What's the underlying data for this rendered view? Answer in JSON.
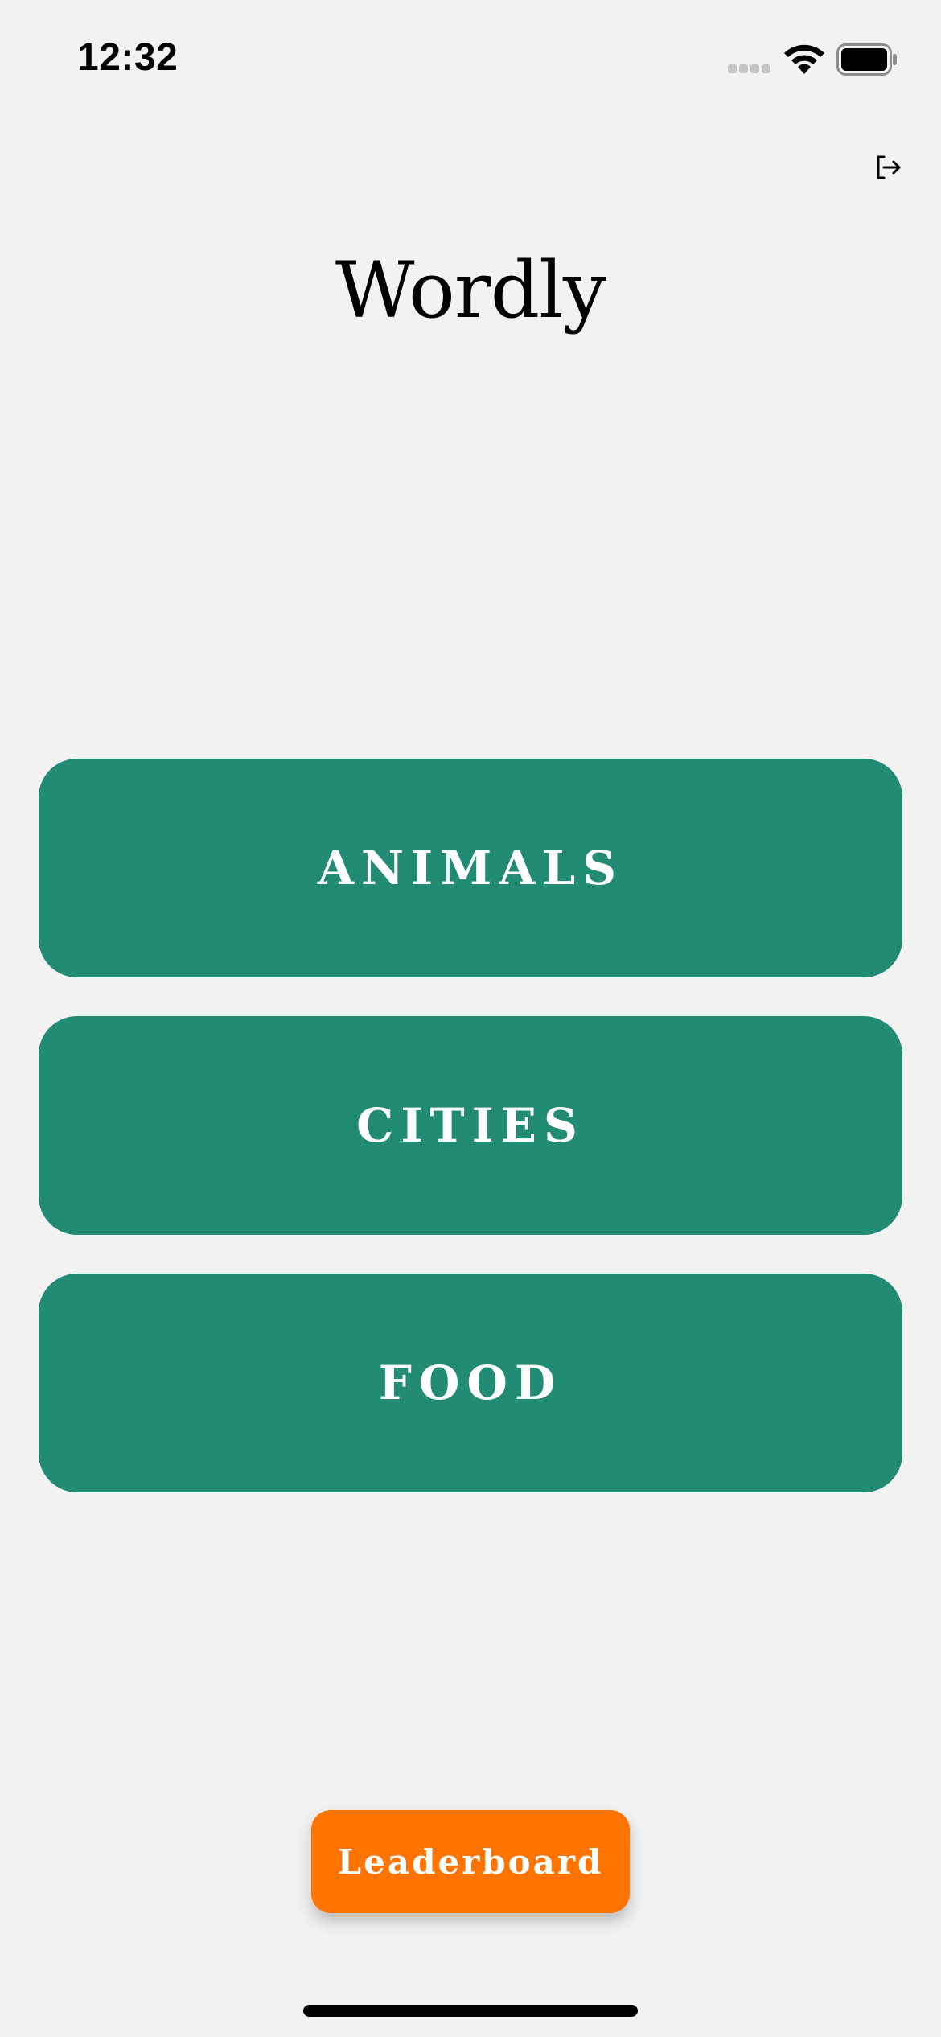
{
  "status_bar": {
    "time": "12:32",
    "signal_icon": "cellular-signal-icon",
    "wifi_icon": "wifi-icon",
    "battery_icon": "battery-icon"
  },
  "header": {
    "logout_icon": "logout-icon"
  },
  "title": "Wordly",
  "categories": [
    {
      "label": "ANIMALS"
    },
    {
      "label": "CITIES"
    },
    {
      "label": "FOOD"
    }
  ],
  "leaderboard": {
    "label": "Leaderboard"
  },
  "colors": {
    "background": "#f2f2f2",
    "category_button": "#218b73",
    "leaderboard_button": "#ff7300",
    "text_on_button": "#ffffff"
  }
}
